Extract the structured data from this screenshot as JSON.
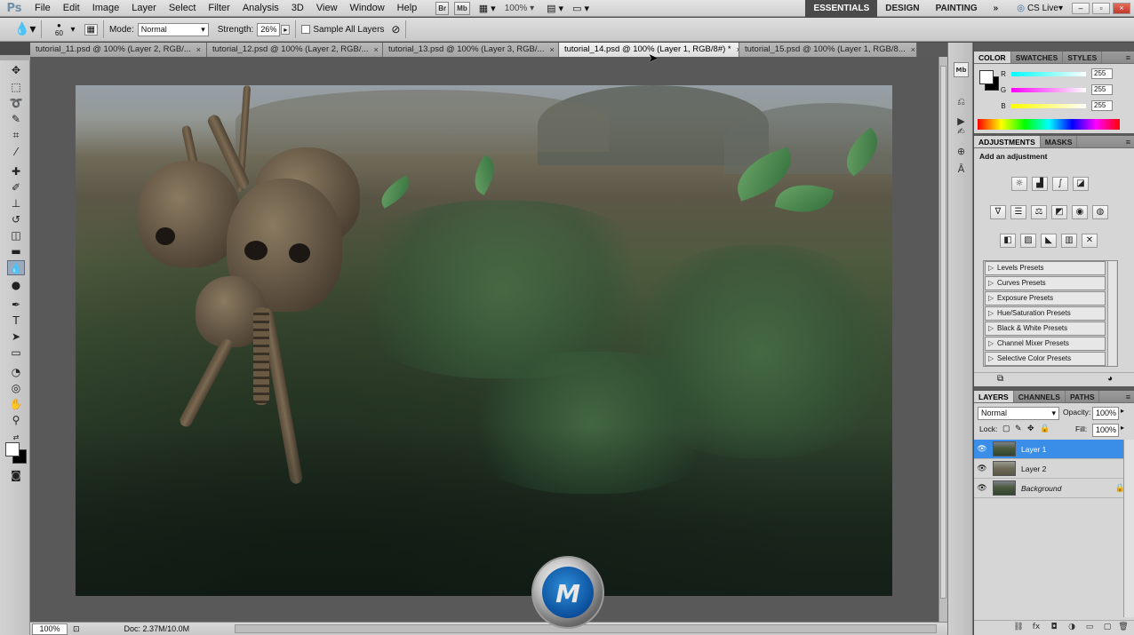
{
  "app": {
    "logo": "Ps"
  },
  "menu": [
    "File",
    "Edit",
    "Image",
    "Layer",
    "Select",
    "Filter",
    "Analysis",
    "3D",
    "View",
    "Window",
    "Help"
  ],
  "appbar": {
    "bridge": "Br",
    "minibridge": "Mb",
    "zoom": "100%"
  },
  "workspaces": [
    "ESSENTIALS",
    "DESIGN",
    "PAINTING"
  ],
  "workspaces_more": "»",
  "cslive": "CS Live",
  "options": {
    "brush_size": "60",
    "mode_label": "Mode:",
    "mode_value": "Normal",
    "strength_label": "Strength:",
    "strength_value": "26%",
    "sample_all_layers": "Sample All Layers"
  },
  "doc_tabs": [
    {
      "label": "tutorial_11.psd @ 100% (Layer 2, RGB/..."
    },
    {
      "label": "tutorial_12.psd @ 100% (Layer 2, RGB/..."
    },
    {
      "label": "tutorial_13.psd @ 100% (Layer 3, RGB/..."
    },
    {
      "label": "tutorial_14.psd @ 100% (Layer 1, RGB/8#) *"
    },
    {
      "label": "tutorial_15.psd @ 100% (Layer 1, RGB/8..."
    }
  ],
  "tab_close": "×",
  "status": {
    "zoom": "100%",
    "doc": "Doc: 2.37M/10.0M",
    "arrow": "▶"
  },
  "color_panel": {
    "tabs": [
      "COLOR",
      "SWATCHES",
      "STYLES"
    ],
    "channels": [
      {
        "label": "R",
        "value": "255"
      },
      {
        "label": "G",
        "value": "255"
      },
      {
        "label": "B",
        "value": "255"
      }
    ]
  },
  "adjustments_panel": {
    "tabs": [
      "ADJUSTMENTS",
      "MASKS"
    ],
    "heading": "Add an adjustment",
    "presets": [
      "Levels Presets",
      "Curves Presets",
      "Exposure Presets",
      "Hue/Saturation Presets",
      "Black & White Presets",
      "Channel Mixer Presets",
      "Selective Color Presets"
    ]
  },
  "layers_panel": {
    "tabs": [
      "LAYERS",
      "CHANNELS",
      "PATHS"
    ],
    "blend_mode": "Normal",
    "opacity_label": "Opacity:",
    "opacity_value": "100%",
    "lock_label": "Lock:",
    "fill_label": "Fill:",
    "fill_value": "100%",
    "layers": [
      {
        "name": "Layer 1",
        "selected": true
      },
      {
        "name": "Layer 2",
        "selected": false
      },
      {
        "name": "Background",
        "selected": false
      }
    ]
  },
  "icons": {
    "eye": "eye-icon",
    "lock": "lock-icon"
  },
  "colors": {
    "selection_blue": "#3b8ee8",
    "active_workspace": "#4a4a4a"
  }
}
